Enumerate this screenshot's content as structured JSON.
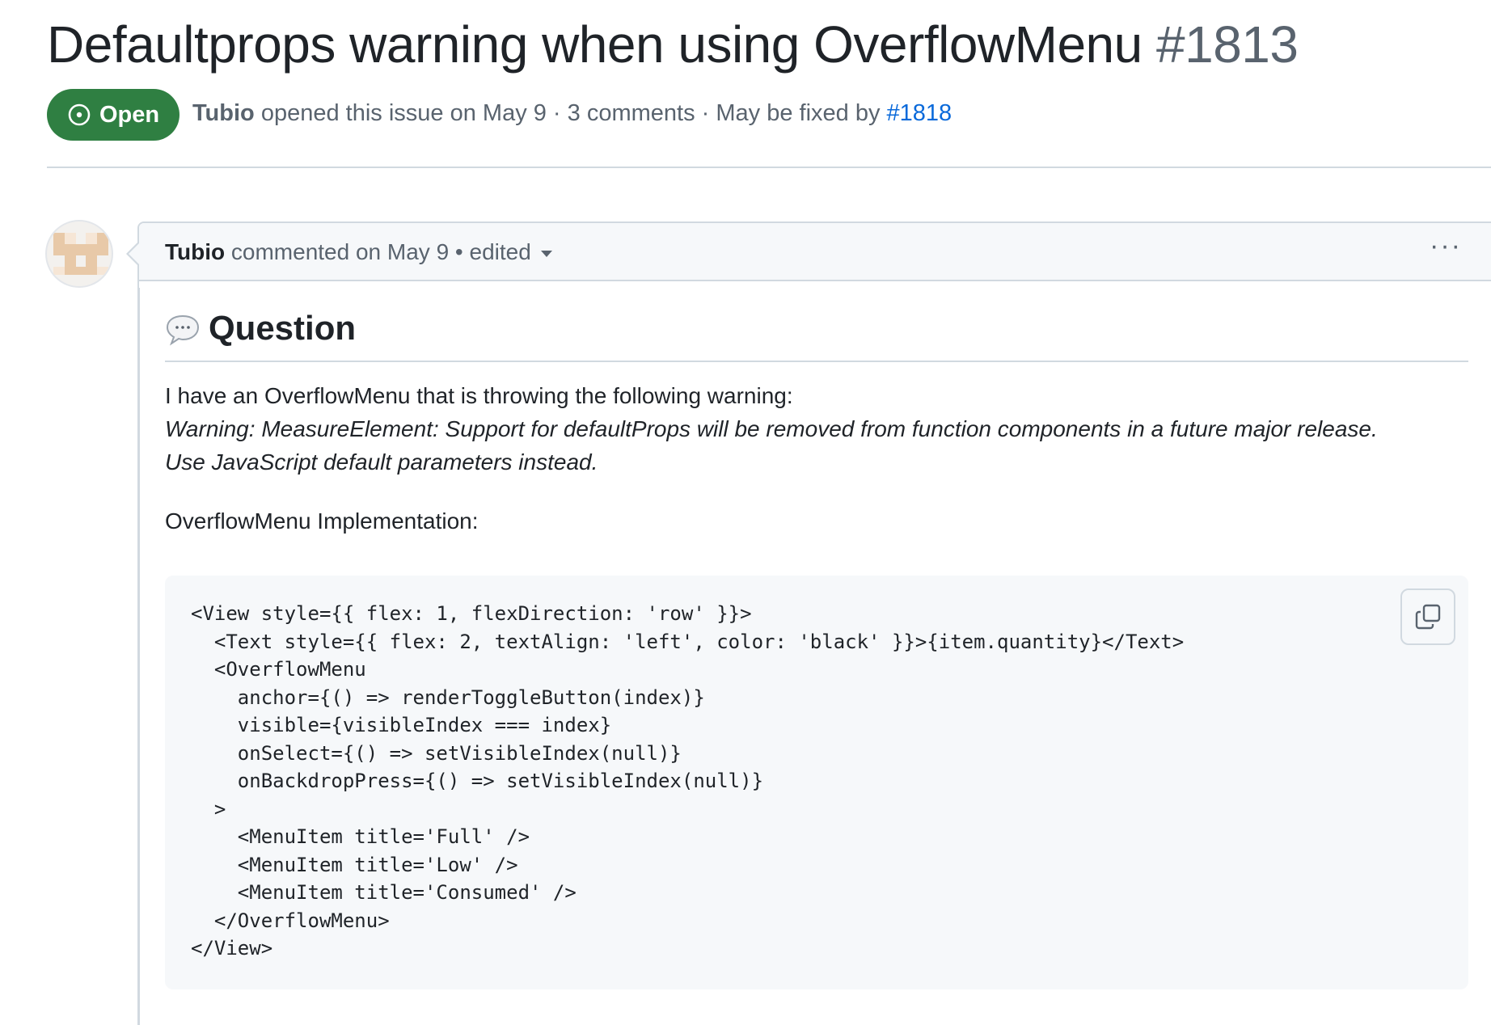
{
  "issue": {
    "title": "Defaultprops warning when using OverflowMenu",
    "number": "#1813",
    "state_label": "Open",
    "meta_author": "Tubio",
    "meta_text": " opened this issue on May 9 · 3 comments · May be fixed by ",
    "fixed_by_link": "#1818"
  },
  "comment": {
    "author": "Tubio",
    "header_text": " commented on May 9 • edited",
    "more_menu": "···",
    "heading": "Question",
    "paragraph_1": "I have an OverflowMenu that is throwing the following warning:",
    "warning_line_1": "Warning: MeasureElement: Support for defaultProps will be removed from function components in a future major release.",
    "warning_line_2": "Use JavaScript default parameters instead.",
    "paragraph_2": "OverflowMenu Implementation:",
    "code": "<View style={{ flex: 1, flexDirection: 'row' }}>\n  <Text style={{ flex: 2, textAlign: 'left', color: 'black' }}>{item.quantity}</Text>\n  <OverflowMenu\n    anchor={() => renderToggleButton(index)}\n    visible={visibleIndex === index}\n    onSelect={() => setVisibleIndex(null)}\n    onBackdropPress={() => setVisibleIndex(null)}\n  >\n    <MenuItem title='Full' />\n    <MenuItem title='Low' />\n    <MenuItem title='Consumed' />\n  </OverflowMenu>\n</View>"
  },
  "icons": {
    "state": "issue-opened-icon",
    "avatar": "identicon-avatar",
    "caret": "triangle-down-icon",
    "more": "kebab-horizontal-icon",
    "heading": "speech-balloon-icon",
    "copy": "copy-icon"
  },
  "colors": {
    "open_green": "#2f7f42",
    "link_blue": "#0969da",
    "muted": "#59636e",
    "border": "#d1d9e0",
    "code_bg": "#f6f8fa"
  }
}
